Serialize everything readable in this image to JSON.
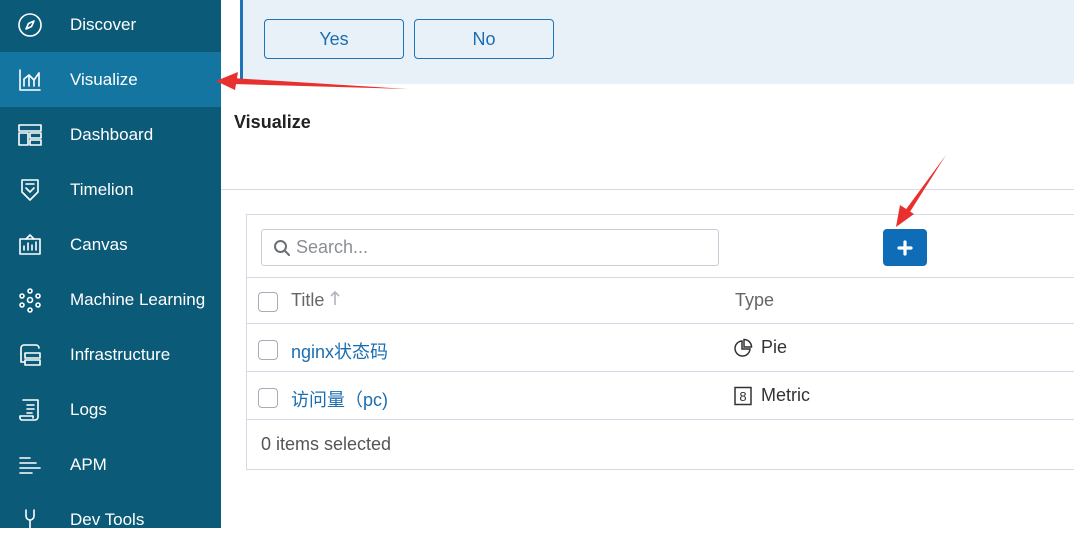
{
  "sidebar": {
    "items": [
      {
        "label": "Discover",
        "icon": "compass-icon",
        "active": false
      },
      {
        "label": "Visualize",
        "icon": "chart-icon",
        "active": true
      },
      {
        "label": "Dashboard",
        "icon": "dashboard-icon",
        "active": false
      },
      {
        "label": "Timelion",
        "icon": "timelion-icon",
        "active": false
      },
      {
        "label": "Canvas",
        "icon": "canvas-icon",
        "active": false
      },
      {
        "label": "Machine Learning",
        "icon": "machine-learning-icon",
        "active": false
      },
      {
        "label": "Infrastructure",
        "icon": "infrastructure-icon",
        "active": false
      },
      {
        "label": "Logs",
        "icon": "logs-icon",
        "active": false
      },
      {
        "label": "APM",
        "icon": "apm-icon",
        "active": false
      },
      {
        "label": "Dev Tools",
        "icon": "wrench-icon",
        "active": false
      }
    ]
  },
  "confirm": {
    "yes_label": "Yes",
    "no_label": "No"
  },
  "page": {
    "title": "Visualize"
  },
  "search": {
    "placeholder": "Search..."
  },
  "table": {
    "headers": {
      "title": "Title",
      "type": "Type"
    },
    "rows": [
      {
        "title": "nginx状态码",
        "type": "Pie",
        "type_icon": "pie-chart-icon"
      },
      {
        "title": "访问量（pc)",
        "type": "Metric",
        "type_icon": "metric-icon",
        "metric_glyph": "8"
      }
    ],
    "footer": "0 items selected"
  },
  "colors": {
    "sidebar_bg": "#0b5a78",
    "sidebar_active": "#1476a0",
    "accent": "#0f6cb6",
    "annotation": "#e8312f"
  }
}
